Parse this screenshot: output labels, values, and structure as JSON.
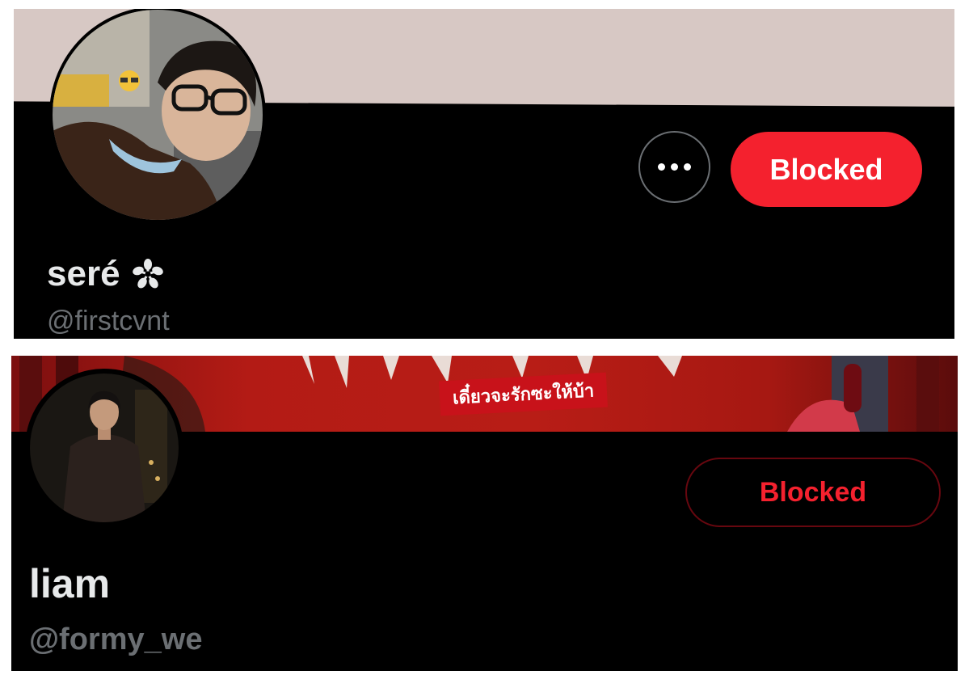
{
  "profile1": {
    "display_name": "seré",
    "name_icon": "cherry-blossom-icon",
    "handle": "@firstcvnt",
    "more_icon": "more-horizontal-icon",
    "status_button": "Blocked",
    "colors": {
      "banner": "#d7c8c4",
      "button_bg": "#f4212e",
      "button_text": "#ffffff"
    }
  },
  "profile2": {
    "display_name": "liam",
    "handle": "@formy_we",
    "banner_text": "เดี๋ยวจะรักซะให้บ้า",
    "status_button": "Blocked",
    "colors": {
      "banner": "#b31b15",
      "button_border": "#67070f",
      "button_text": "#f4212e"
    }
  }
}
